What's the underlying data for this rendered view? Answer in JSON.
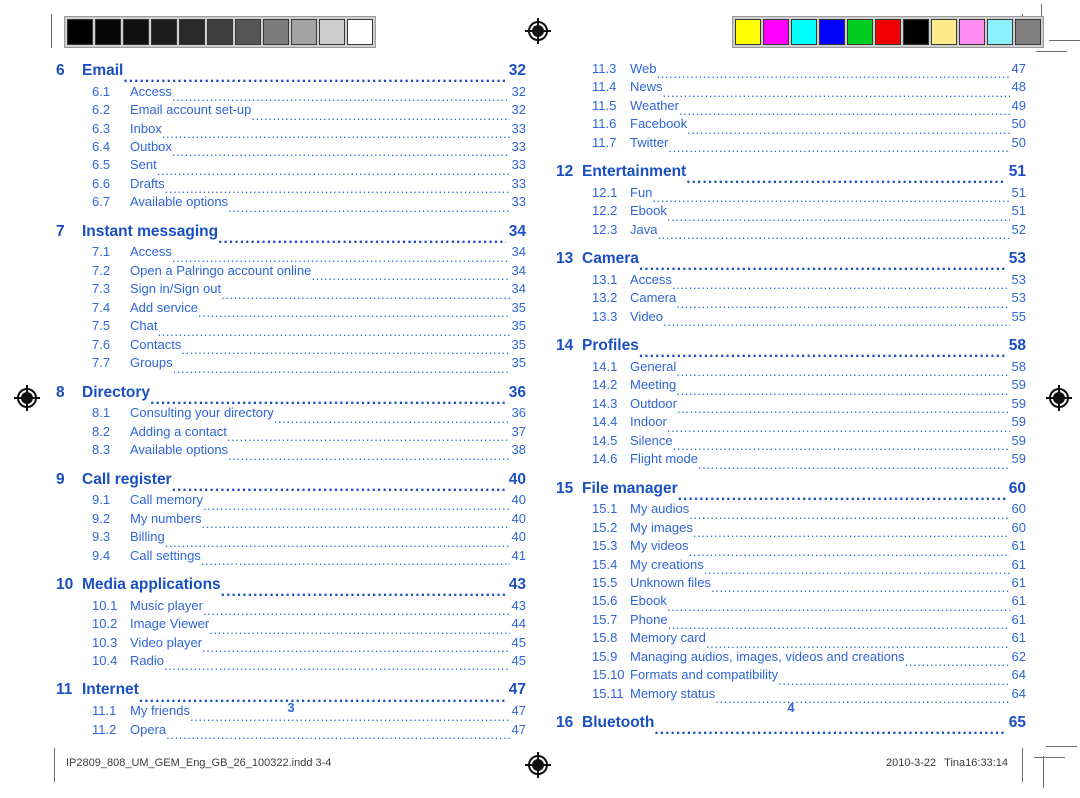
{
  "document": {
    "title": "Table of contents",
    "accent_color": "#1a4fc4",
    "subaccent_color": "#2f66d8"
  },
  "print_marks": {
    "gray_bar": {
      "name": "grayscale-step-wedge",
      "patches": [
        "#000000",
        "#070707",
        "#101010",
        "#1c1c1c",
        "#292929",
        "#3f3f3f",
        "#555555",
        "#7b7b7b",
        "#a3a3a3",
        "#cccccc",
        "#ffffff"
      ]
    },
    "color_bar": {
      "name": "cmyk-color-control-bar",
      "patches": [
        "#ffff00",
        "#ff00ff",
        "#00ffff",
        "#0000ff",
        "#00cc22",
        "#ee0000",
        "#000000",
        "#ffeb8c",
        "#ff8cf0",
        "#8cf0ff",
        "#808080"
      ]
    },
    "registration_mark_label": "registration-target"
  },
  "left_page": {
    "folio": "3",
    "entries": [
      {
        "level": 1,
        "num": "6",
        "label": "Email",
        "page": "32"
      },
      {
        "level": 2,
        "num": "6.1",
        "label": "Access",
        "page": "32"
      },
      {
        "level": 2,
        "num": "6.2",
        "label": "Email account set-up",
        "page": "32"
      },
      {
        "level": 2,
        "num": "6.3",
        "label": "Inbox",
        "page": "33"
      },
      {
        "level": 2,
        "num": "6.4",
        "label": "Outbox",
        "page": "33"
      },
      {
        "level": 2,
        "num": "6.5",
        "label": "Sent",
        "page": "33"
      },
      {
        "level": 2,
        "num": "6.6",
        "label": "Drafts",
        "page": "33"
      },
      {
        "level": 2,
        "num": "6.7",
        "label": "Available options",
        "page": "33"
      },
      {
        "level": 1,
        "num": "7",
        "label": "Instant messaging",
        "page": "34"
      },
      {
        "level": 2,
        "num": "7.1",
        "label": "Access",
        "page": "34"
      },
      {
        "level": 2,
        "num": "7.2",
        "label": "Open a Palringo account online",
        "page": "34"
      },
      {
        "level": 2,
        "num": "7.3",
        "label": "Sign in/Sign out",
        "page": "34"
      },
      {
        "level": 2,
        "num": "7.4",
        "label": "Add service",
        "page": "35"
      },
      {
        "level": 2,
        "num": "7.5",
        "label": "Chat",
        "page": "35"
      },
      {
        "level": 2,
        "num": "7.6",
        "label": "Contacts",
        "page": "35"
      },
      {
        "level": 2,
        "num": "7.7",
        "label": "Groups",
        "page": "35"
      },
      {
        "level": 1,
        "num": "8",
        "label": "Directory",
        "page": "36"
      },
      {
        "level": 2,
        "num": "8.1",
        "label": "Consulting your directory",
        "page": "36"
      },
      {
        "level": 2,
        "num": "8.2",
        "label": "Adding a contact",
        "page": "37"
      },
      {
        "level": 2,
        "num": "8.3",
        "label": "Available options",
        "page": "38"
      },
      {
        "level": 1,
        "num": "9",
        "label": "Call register",
        "page": "40"
      },
      {
        "level": 2,
        "num": "9.1",
        "label": "Call memory",
        "page": "40"
      },
      {
        "level": 2,
        "num": "9.2",
        "label": "My numbers",
        "page": "40"
      },
      {
        "level": 2,
        "num": "9.3",
        "label": "Billing",
        "page": "40"
      },
      {
        "level": 2,
        "num": "9.4",
        "label": "Call settings",
        "page": "41"
      },
      {
        "level": 1,
        "num": "10",
        "label": "Media applications",
        "page": "43"
      },
      {
        "level": 2,
        "num": "10.1",
        "label": "Music player",
        "page": "43"
      },
      {
        "level": 2,
        "num": "10.2",
        "label": "Image Viewer",
        "page": "44"
      },
      {
        "level": 2,
        "num": "10.3",
        "label": "Video player",
        "page": "45"
      },
      {
        "level": 2,
        "num": "10.4",
        "label": "Radio",
        "page": "45"
      },
      {
        "level": 1,
        "num": "11",
        "label": "Internet",
        "page": "47"
      },
      {
        "level": 2,
        "num": "11.1",
        "label": "My friends",
        "page": "47"
      },
      {
        "level": 2,
        "num": "11.2",
        "label": "Opera",
        "page": "47"
      }
    ]
  },
  "right_page": {
    "folio": "4",
    "entries": [
      {
        "level": 2,
        "num": "11.3",
        "label": "Web",
        "page": "47"
      },
      {
        "level": 2,
        "num": "11.4",
        "label": "News",
        "page": "48"
      },
      {
        "level": 2,
        "num": "11.5",
        "label": "Weather",
        "page": "49"
      },
      {
        "level": 2,
        "num": "11.6",
        "label": "Facebook",
        "page": "50"
      },
      {
        "level": 2,
        "num": "11.7",
        "label": "Twitter",
        "page": "50"
      },
      {
        "level": 1,
        "num": "12",
        "label": "Entertainment",
        "page": "51"
      },
      {
        "level": 2,
        "num": "12.1",
        "label": "Fun",
        "page": "51"
      },
      {
        "level": 2,
        "num": "12.2",
        "label": "Ebook",
        "page": "51"
      },
      {
        "level": 2,
        "num": "12.3",
        "label": "Java",
        "page": "52"
      },
      {
        "level": 1,
        "num": "13",
        "label": "Camera",
        "page": "53"
      },
      {
        "level": 2,
        "num": "13.1",
        "label": "Access",
        "page": "53"
      },
      {
        "level": 2,
        "num": "13.2",
        "label": "Camera",
        "page": "53"
      },
      {
        "level": 2,
        "num": "13.3",
        "label": "Video",
        "page": "55"
      },
      {
        "level": 1,
        "num": "14",
        "label": "Profiles",
        "page": "58"
      },
      {
        "level": 2,
        "num": "14.1",
        "label": "General",
        "page": "58"
      },
      {
        "level": 2,
        "num": "14.2",
        "label": "Meeting",
        "page": "59"
      },
      {
        "level": 2,
        "num": "14.3",
        "label": "Outdoor",
        "page": "59"
      },
      {
        "level": 2,
        "num": "14.4",
        "label": "Indoor",
        "page": "59"
      },
      {
        "level": 2,
        "num": "14.5",
        "label": "Silence",
        "page": "59"
      },
      {
        "level": 2,
        "num": "14.6",
        "label": "Flight mode",
        "page": "59"
      },
      {
        "level": 1,
        "num": "15",
        "label": "File manager",
        "page": "60"
      },
      {
        "level": 2,
        "num": "15.1",
        "label": "My audios",
        "page": "60"
      },
      {
        "level": 2,
        "num": "15.2",
        "label": "My images",
        "page": "60"
      },
      {
        "level": 2,
        "num": "15.3",
        "label": "My videos",
        "page": "61"
      },
      {
        "level": 2,
        "num": "15.4",
        "label": "My creations",
        "page": "61"
      },
      {
        "level": 2,
        "num": "15.5",
        "label": "Unknown files",
        "page": "61"
      },
      {
        "level": 2,
        "num": "15.6",
        "label": "Ebook",
        "page": "61"
      },
      {
        "level": 2,
        "num": "15.7",
        "label": "Phone",
        "page": "61"
      },
      {
        "level": 2,
        "num": "15.8",
        "label": "Memory card",
        "page": "61"
      },
      {
        "level": 2,
        "num": "15.9",
        "label": "Managing audios, images, videos and creations",
        "page": "62"
      },
      {
        "level": 2,
        "num": "15.10",
        "label": "Formats and compatibility",
        "page": "64"
      },
      {
        "level": 2,
        "num": "15.11",
        "label": "Memory status",
        "page": "64"
      },
      {
        "level": 1,
        "num": "16",
        "label": "Bluetooth",
        "page": "65"
      }
    ]
  },
  "footer": {
    "file_slug": "IP2809_808_UM_GEM_Eng_GB_26_100322.indd   3-4",
    "date": "2010-3-22",
    "operator_time": "Tina16:33:14"
  }
}
